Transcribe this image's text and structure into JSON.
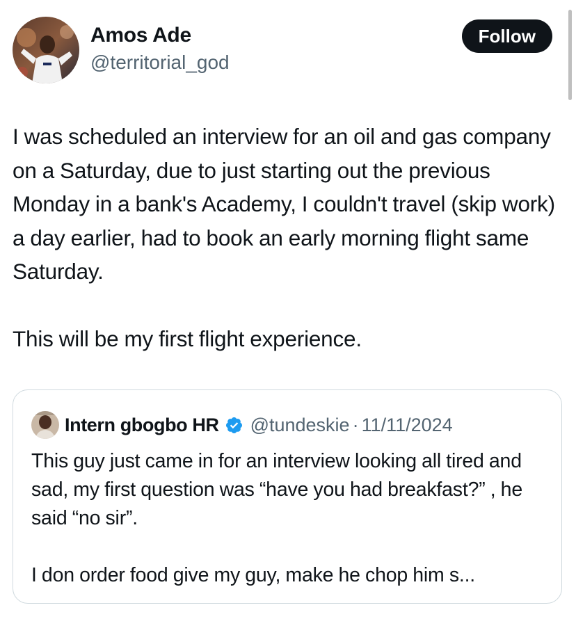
{
  "author": {
    "display_name": "Amos Ade",
    "handle": "@territorial_god",
    "avatar_icon": "user-avatar-icon"
  },
  "follow_button": {
    "label": "Follow"
  },
  "tweet": {
    "paragraphs": [
      "I was scheduled an interview for an oil and gas company on a Saturday, due to just starting out the previous Monday in a bank's Academy, I couldn't travel (skip work) a day earlier, had to book an early morning flight same Saturday.",
      "This will be my first flight experience."
    ]
  },
  "quoted_tweet": {
    "display_name": "Intern gbogbo HR",
    "verified": true,
    "handle": "@tundeskie",
    "separator": "·",
    "date": "11/11/2024",
    "paragraphs": [
      "This guy just came in for an interview looking all tired and sad, my first question was “have you had breakfast?” , he said “no sir”.",
      "I don order food give my guy, make he chop him s..."
    ]
  },
  "colors": {
    "text_primary": "#0f1419",
    "text_secondary": "#536471",
    "follow_bg": "#0f1419",
    "verified_blue": "#1d9bf0",
    "border": "#cfd9de"
  }
}
